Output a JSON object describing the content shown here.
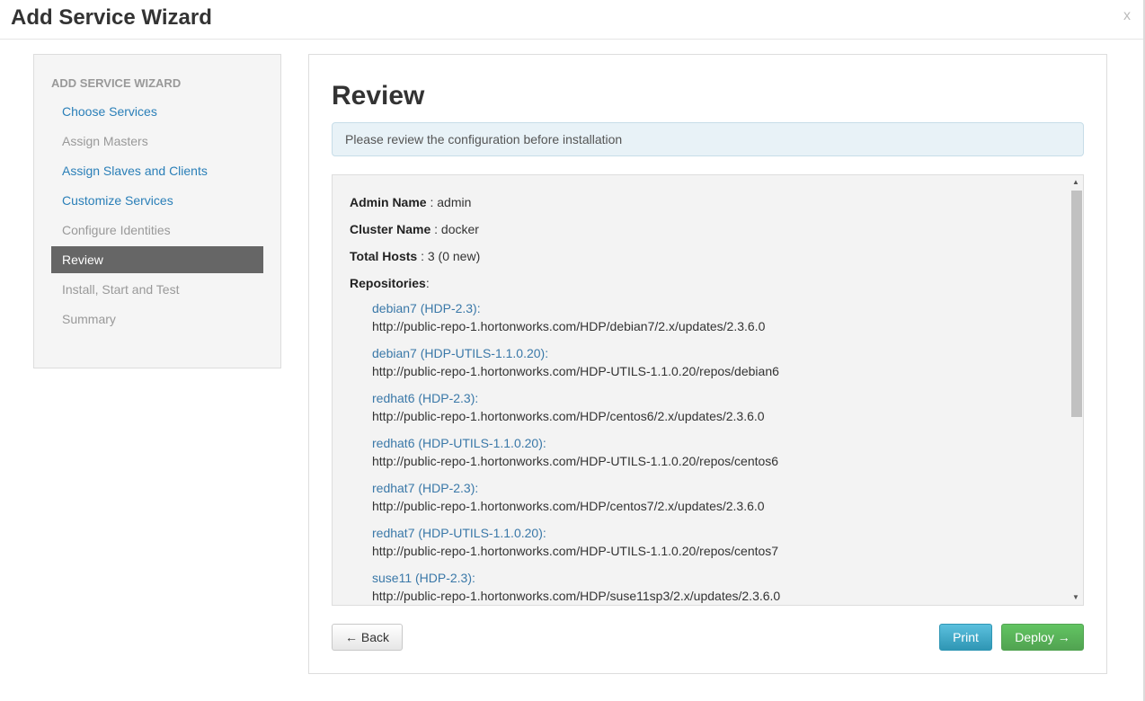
{
  "window": {
    "title": "Add Service Wizard",
    "close_label": "x"
  },
  "sidebar": {
    "header": "ADD SERVICE WIZARD",
    "items": [
      {
        "label": "Choose Services",
        "state": "link"
      },
      {
        "label": "Assign Masters",
        "state": "disabled"
      },
      {
        "label": "Assign Slaves and Clients",
        "state": "link"
      },
      {
        "label": "Customize Services",
        "state": "link"
      },
      {
        "label": "Configure Identities",
        "state": "disabled"
      },
      {
        "label": "Review",
        "state": "active"
      },
      {
        "label": "Install, Start and Test",
        "state": "disabled"
      },
      {
        "label": "Summary",
        "state": "disabled"
      }
    ]
  },
  "main": {
    "title": "Review",
    "alert": "Please review the configuration before installation",
    "fields": {
      "admin_name": {
        "label": "Admin Name",
        "value": " : admin"
      },
      "cluster_name": {
        "label": "Cluster Name",
        "value": " : docker"
      },
      "total_hosts": {
        "label": "Total Hosts",
        "value": " : 3 (0 new)"
      },
      "repositories": {
        "label": "Repositories",
        "value": ":"
      }
    },
    "repositories": [
      {
        "name": "debian7 (HDP-2.3):",
        "url": "http://public-repo-1.hortonworks.com/HDP/debian7/2.x/updates/2.3.6.0"
      },
      {
        "name": "debian7 (HDP-UTILS-1.1.0.20):",
        "url": "http://public-repo-1.hortonworks.com/HDP-UTILS-1.1.0.20/repos/debian6"
      },
      {
        "name": "redhat6 (HDP-2.3):",
        "url": "http://public-repo-1.hortonworks.com/HDP/centos6/2.x/updates/2.3.6.0"
      },
      {
        "name": "redhat6 (HDP-UTILS-1.1.0.20):",
        "url": "http://public-repo-1.hortonworks.com/HDP-UTILS-1.1.0.20/repos/centos6"
      },
      {
        "name": "redhat7 (HDP-2.3):",
        "url": "http://public-repo-1.hortonworks.com/HDP/centos7/2.x/updates/2.3.6.0"
      },
      {
        "name": "redhat7 (HDP-UTILS-1.1.0.20):",
        "url": "http://public-repo-1.hortonworks.com/HDP-UTILS-1.1.0.20/repos/centos7"
      },
      {
        "name": "suse11 (HDP-2.3):",
        "url": "http://public-repo-1.hortonworks.com/HDP/suse11sp3/2.x/updates/2.3.6.0"
      }
    ],
    "buttons": {
      "back": "← Back",
      "print": "Print",
      "deploy": "Deploy →"
    }
  },
  "colors": {
    "link": "#2a7fb8",
    "repo_name": "#3a78a8",
    "active_nav": "#666666",
    "print_btn": "#2f96b4",
    "deploy_btn": "#51a351"
  }
}
